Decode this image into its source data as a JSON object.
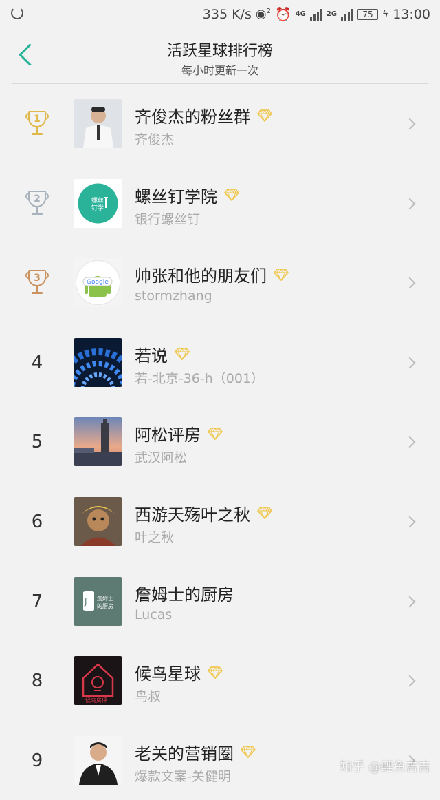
{
  "status_bar": {
    "speed": "335 K/s",
    "hotspot_count": "2",
    "net1": "4G",
    "net2": "2G",
    "battery": "75",
    "time": "13:00"
  },
  "header": {
    "title": "活跃星球排行榜",
    "subtitle": "每小时更新一次"
  },
  "colors": {
    "accent": "#2bb39a",
    "gold": "#e0b84a",
    "silver": "#a8b2bc",
    "bronze": "#c9925e",
    "diamond": "#f0c956"
  },
  "rankings": [
    {
      "rank": "1",
      "name": "齐俊杰的粉丝群",
      "owner": "齐俊杰",
      "diamond": true
    },
    {
      "rank": "2",
      "name": "螺丝钉学院",
      "owner": "银行螺丝钉",
      "diamond": true
    },
    {
      "rank": "3",
      "name": "帅张和他的朋友们",
      "owner": "stormzhang",
      "diamond": true
    },
    {
      "rank": "4",
      "name": "若说",
      "owner": "若-北京-36-h（001）",
      "diamond": true
    },
    {
      "rank": "5",
      "name": "阿松评房",
      "owner": "武汉阿松",
      "diamond": true
    },
    {
      "rank": "6",
      "name": "西游天殇叶之秋",
      "owner": "叶之秋",
      "diamond": true
    },
    {
      "rank": "7",
      "name": "詹姆士的厨房",
      "owner": "Lucas",
      "diamond": false
    },
    {
      "rank": "8",
      "name": "候鸟星球",
      "owner": "鸟叔",
      "diamond": true
    },
    {
      "rank": "9",
      "name": "老关的营销圈",
      "owner": "爆款文案-关健明",
      "diamond": true
    }
  ],
  "watermark": "知乎 @鲤鱼吉吉"
}
